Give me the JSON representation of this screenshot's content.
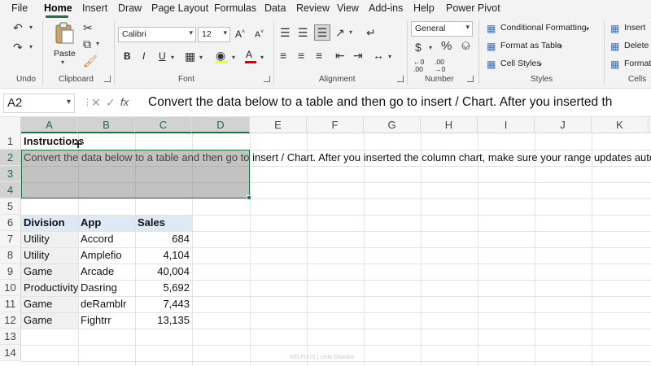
{
  "menu": {
    "items": [
      "File",
      "Home",
      "Insert",
      "Draw",
      "Page Layout",
      "Formulas",
      "Data",
      "Review",
      "View",
      "Add-ins",
      "Help",
      "Power Pivot"
    ],
    "active": "Home"
  },
  "ribbon": {
    "undo_label": "Undo",
    "clipboard": {
      "label": "Clipboard",
      "paste_label": "Paste"
    },
    "font": {
      "label": "Font",
      "font_name": "Calibri",
      "font_size": "12",
      "bold": "B",
      "italic": "I",
      "underline": "U"
    },
    "alignment": {
      "label": "Alignment"
    },
    "number": {
      "label": "Number",
      "format": "General"
    },
    "styles": {
      "label": "Styles",
      "conditional_formatting": "Conditional Formatting",
      "format_as_table": "Format as Table",
      "cell_styles": "Cell Styles"
    },
    "cells": {
      "label": "Cells",
      "insert": "Insert",
      "delete": "Delete",
      "format": "Format"
    }
  },
  "formula_bar": {
    "name_box": "A2",
    "content": "Convert the data below to a table and then go to insert / Chart. After you inserted th"
  },
  "grid": {
    "columns": [
      "A",
      "B",
      "C",
      "D",
      "E",
      "F",
      "G",
      "H",
      "I",
      "J",
      "K"
    ],
    "rows": [
      "1",
      "2",
      "3",
      "4",
      "5",
      "6",
      "7",
      "8",
      "9",
      "10",
      "11",
      "12",
      "13",
      "14"
    ],
    "instructions_title": "Instructions",
    "instructions_text": "Convert the data below to a table and then go to insert / Chart. After you inserted the column chart, make sure your range updates automatica",
    "table": {
      "headers": [
        "Division",
        "App",
        "Sales"
      ],
      "rows": [
        [
          "Utility",
          "Accord",
          "684"
        ],
        [
          "Utility",
          "Amplefio",
          "4,104"
        ],
        [
          "Game",
          "Arcade",
          "40,004"
        ],
        [
          "Productivity",
          "Dasring",
          "5,692"
        ],
        [
          "Game",
          "deRamblr",
          "7,443"
        ],
        [
          "Game",
          "Fightrr",
          "13,135"
        ]
      ]
    }
  },
  "watermark": "XELPLUS | Leila Gharani",
  "colors": {
    "accent": "#217346",
    "header_fill": "#dde9f5",
    "selection": "#a8a8a8"
  }
}
